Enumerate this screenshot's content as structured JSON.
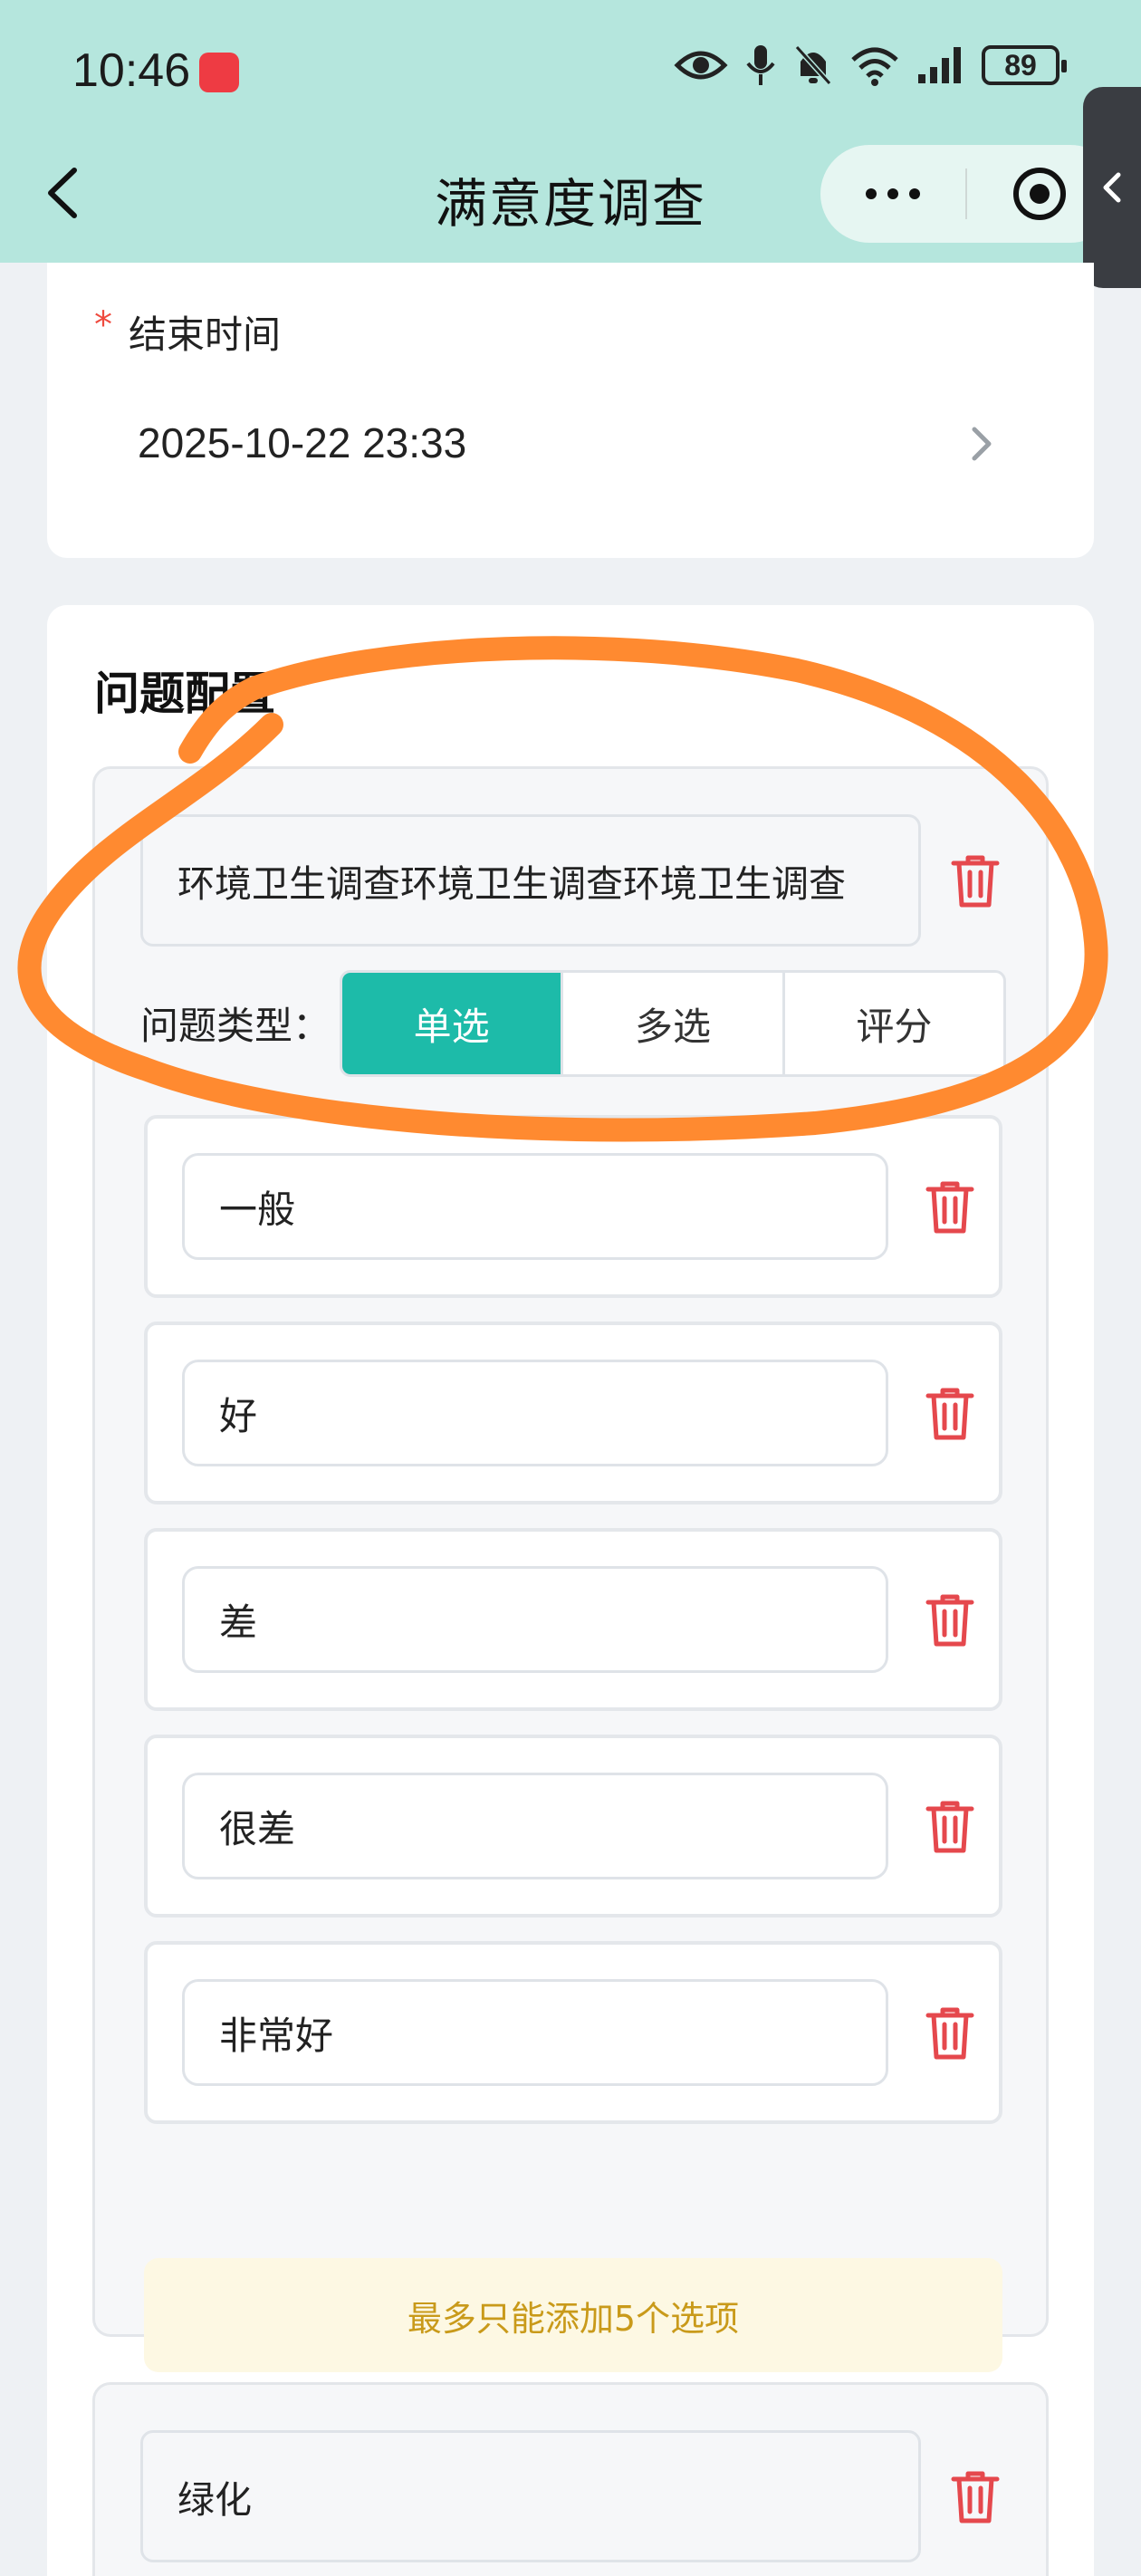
{
  "status_bar": {
    "time": "10:46",
    "battery": "89",
    "icons": [
      "eye-icon",
      "microphone-icon",
      "bell-off-icon",
      "wifi-icon",
      "signal-icon",
      "battery-icon"
    ]
  },
  "header": {
    "title": "满意度调查",
    "back_icon": "chevron-left-icon",
    "more_icon": "more-dots-icon",
    "close_icon": "target-circle-icon",
    "side_tab_icon": "chevron-left-icon"
  },
  "end_time": {
    "required_mark": "*",
    "label": "结束时间",
    "value": "2025-10-22 23:33"
  },
  "questions": {
    "section_title": "问题配置",
    "type_label": "问题类型：",
    "items": [
      {
        "title": "环境卫生调查环境卫生调查环境卫生调查",
        "type_options": [
          "单选",
          "多选",
          "评分"
        ],
        "selected_type": "单选",
        "options": [
          "一般",
          "好",
          "差",
          "很差",
          "非常好"
        ],
        "notice": "最多只能添加5个选项"
      },
      {
        "title": "绿化"
      }
    ]
  },
  "colors": {
    "header_bg": "#b5e6dd",
    "accent": "#1dbba9",
    "delete": "#e5484d",
    "notice_text": "#c99a1a",
    "annotation": "#ff8a30"
  }
}
